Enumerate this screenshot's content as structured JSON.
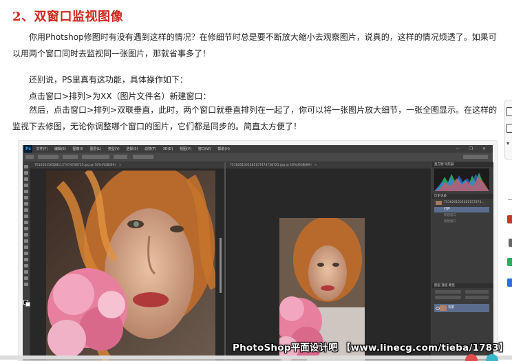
{
  "article": {
    "title": "2、双窗口监视图像",
    "para1": "你用Photshop修图时有没有遇到这样的情况？在修细节时总是要不断放大缩小去观察图片，说真的，这样的情况烦透了。如果可以用两个窗口同时去监视同一张图片，那就省事多了！",
    "para2": "还别说，PS里真有这功能，具体操作如下：",
    "para3": "点击窗口>排列>为XX（图片文件名）新建窗口：",
    "para4": "然后，点击窗口>排列>双联垂直，此时，两个窗口就垂直排列在一起了，你可以将一张图片放大细节，一张全图显示。在这样的监视下去修图，无论你调整哪个窗口的图片，它们都是同步的。简直太方便了！"
  },
  "screenshot": {
    "watermark": "PhotoShop平面设计吧 【www.linecg.com/tieba/1783】",
    "app_logo": "Ps",
    "menu": [
      "文件(F)",
      "编辑(E)",
      "图像(I)",
      "图层(L)",
      "类型(Y)",
      "选择(S)",
      "滤镜(T)",
      "3D(D)",
      "视图(V)",
      "窗口(W)",
      "帮助(H)"
    ],
    "window_buttons": "— ❐ ✕",
    "doc1_tab": "7516201505281157474738725.jpg @ 50%(RGB/8#)",
    "doc2_tab": "7516201505281157474738725.jpg @ 16%(RGB/8#)",
    "panels": {
      "histogram_tab": "直方图  导航器",
      "history_tab": "历史记录",
      "history_file": "7516201505281157474...",
      "history_open": "打开",
      "history_item2": "新建窗口",
      "history_item3": "新建窗口",
      "layers_tab": "图层  通道  路径",
      "layer_name": "背景"
    },
    "colors": {
      "ps_dark": "#3c3c3c",
      "ps_canvas": "#282828",
      "hair": "#c9762e",
      "flower": "#e7809f"
    }
  }
}
